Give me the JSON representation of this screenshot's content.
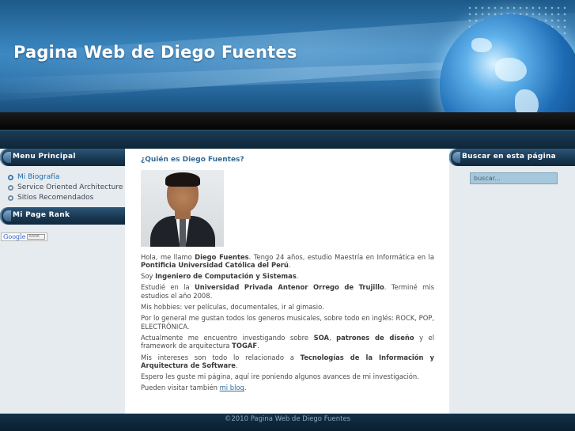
{
  "header": {
    "site_title": "Pagina Web de Diego Fuentes"
  },
  "sidebar_left": {
    "menu_title": "Menu Principal",
    "items": [
      {
        "label": "Mi Biografía",
        "active": true
      },
      {
        "label": "Service Oriented Architecture",
        "active": false
      },
      {
        "label": "Sitios Recomendados",
        "active": false
      }
    ],
    "pagerank_title": "Mi Page Rank",
    "pagerank_widget": {
      "brand": "Google",
      "label": "RANK"
    }
  },
  "sidebar_right": {
    "search_title": "Buscar en esta página",
    "search_value": "buscar..."
  },
  "content": {
    "heading": "¿Quién es Diego Fuentes?",
    "p1": {
      "a": "Hola, me llamo ",
      "b": "Diego Fuentes",
      "c": ". Tengo 24 años, estudio Maestría en Informática en la ",
      "d": "Pontificia Universidad Católica del Perú",
      "e": "."
    },
    "p2": {
      "a": "Soy ",
      "b": "Ingeniero de Computación y Sistemas",
      "c": "."
    },
    "p3": {
      "a": "Estudié en la ",
      "b": "Universidad Privada Antenor Orrego de Trujillo",
      "c": ". Terminé mis estudios el año 2008."
    },
    "p4": "Mis hobbies: ver películas, documentales, ir al gimasio.",
    "p5": "Por lo general me gustan todos los generos musicales, sobre todo en inglés: ROCK, POP, ELECTRÓNICA.",
    "p6": {
      "a": "Actualmente me encuentro investigando sobre ",
      "b": "SOA",
      "c": ", ",
      "d": "patrones de diseño",
      "e": " y el framework de arquitectura ",
      "f": "TOGAF",
      "g": "."
    },
    "p7": {
      "a": "Mis intereses son todo lo relacionado a ",
      "b": "Tecnologías de la Información y Arquitectura de Software",
      "c": "."
    },
    "p8": "Espero les guste mi página, aquí ire poniendo algunos avances de mi investigación.",
    "p9": {
      "a": "Pueden visitar también ",
      "link": "mi blog",
      "c": "."
    }
  },
  "footer": {
    "text": "©2010 Pagina Web de Diego Fuentes"
  },
  "colors": {
    "link": "#2f6a98",
    "sidebar_bg": "#e6ebef",
    "header_blue": "#2c74ae",
    "footer_bg": "#0a1f30"
  }
}
